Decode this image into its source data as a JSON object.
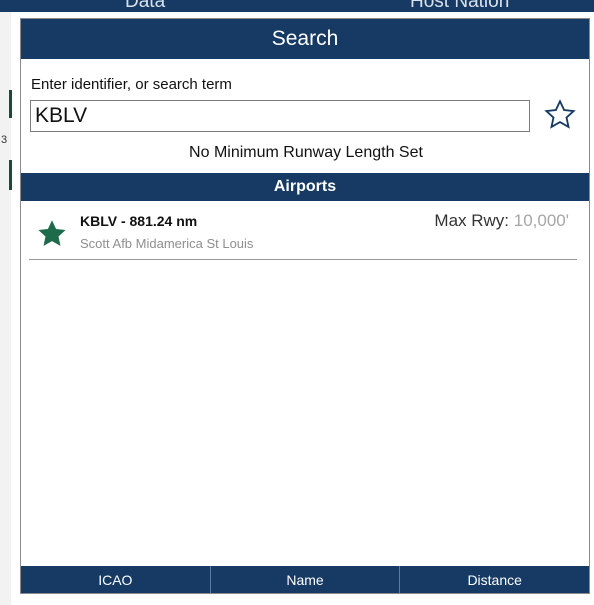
{
  "background": {
    "header_left": "Data",
    "header_right": "Host Nation",
    "left_char": "3",
    "bottom_text": "..."
  },
  "modal": {
    "title": "Search",
    "search": {
      "label": "Enter identifier, or search term",
      "value": "KBLV",
      "placeholder": ""
    },
    "favorite_icon": "star-outline-icon",
    "runway_note": "No Minimum Runway Length Set",
    "section_title": "Airports",
    "results": [
      {
        "title": "KBLV - 881.24 nm",
        "subtitle": "Scott Afb Midamerica St Louis",
        "rwy_label": "Max Rwy: ",
        "rwy_value": "10,000'",
        "icon": "star-filled-icon"
      }
    ],
    "sort_tabs": [
      "ICAO",
      "Name",
      "Distance"
    ]
  },
  "colors": {
    "header_bg": "#163a63",
    "star_fill": "#1e6b4c",
    "star_outline": "#163a63",
    "subtitle": "#8f8f8f"
  }
}
